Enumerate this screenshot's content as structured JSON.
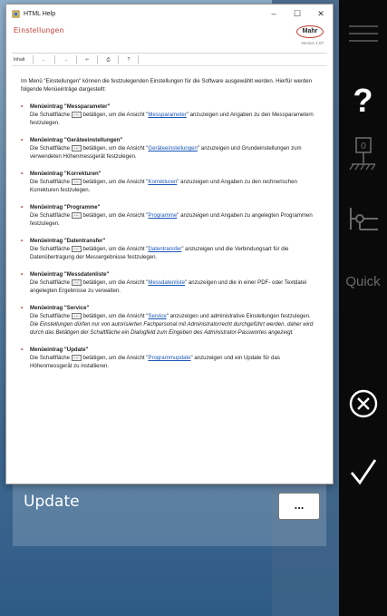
{
  "background": {
    "tile_label": "Update",
    "more_button": "..."
  },
  "right_panel": {
    "help": "?",
    "zero": "0",
    "quick": "Quick"
  },
  "window": {
    "title": "HTML Help",
    "minimize": "–",
    "maximize": "☐",
    "close": "✕"
  },
  "header": {
    "title": "Einstellungen",
    "logo": "Mahr",
    "version": "Version 1.07"
  },
  "toolbar": [
    "Inhalt",
    "←",
    "→",
    "⇐",
    "⎙",
    "?"
  ],
  "content": {
    "intro": "Im Menü \"Einstellungen\" können die festzulegenden Einstellungen für die Software ausgewählt werden. Hierfür werden folgende Menüeinträge dargestellt:",
    "entries": [
      {
        "heading": "Menüeintrag \"Messparameter\"",
        "pre": "Die Schaltfläche",
        "mid": "betätigen, um die Ansicht \"",
        "link": "Messparameter",
        "post": "\" anzuzeigen und Angaben zu den Messparametern festzulegen."
      },
      {
        "heading": "Menüeintrag \"Geräteeinstellungen\"",
        "pre": "Die Schaltfläche",
        "mid": "betätigen, um die Ansicht \"",
        "link": "Geräteeinstellungen",
        "post": "\" anzuzeigen und Grundeinstellungen zum verwendeten Höhenmessgerät festzulegen."
      },
      {
        "heading": "Menüeintrag \"Korrekturen\"",
        "pre": "Die Schaltfläche",
        "mid": "betätigen, um die Ansicht \"",
        "link": "Korrekturen",
        "post": "\" anzuzeigen und Angaben zu den rechnerischen Korrekturen festzulegen."
      },
      {
        "heading": "Menüeintrag \"Programme\"",
        "pre": "Die Schaltfläche",
        "mid": "betätigen, um die Ansicht \"",
        "link": "Programme",
        "post": "\" anzuzeigen und Angaben zu angelegten Programmen festzulegen."
      },
      {
        "heading": "Menüeintrag \"Datentransfer\"",
        "pre": "Die Schaltfläche",
        "mid": "betätigen, um die Ansicht \"",
        "link": "Datentransfer",
        "post": "\" anzuzeigen und die Verbindungsart für die Datenübertragung der Messergebnisse festzulegen."
      },
      {
        "heading": "Menüeintrag \"Messdatenliste\"",
        "pre": "Die Schaltfläche",
        "mid": "betätigen, um die Ansicht \"",
        "link": "Messdatenliste",
        "post": "\" anzuzeigen und die in einer PDF- oder Textdatei angelegten Ergebnisse zu verwalten."
      },
      {
        "heading": "Menüeintrag \"Service\"",
        "pre": "Die Schaltfläche",
        "mid": "betätigen, um die Ansicht \"",
        "link": "Service",
        "post": "\" anzuzeigen und administrative Einstellungen festzulegen.",
        "note": "Die Einstellungen dürfen nur von autorisierten Fachpersonal mit Administratorrecht durchgeführt werden, daher wird durch das Betätigen der Schaltfläche ein Dialogfeld zum Eingeben des Administrator-Passwortes angezeigt."
      },
      {
        "heading": "Menüeintrag \"Update\"",
        "pre": "Die Schaltfläche",
        "mid": "betätigen, um die Ansicht \"",
        "link": "Programmupdate",
        "post": "\" anzuzeigen und ein Update für das Höhenmessgerät zu installieren."
      }
    ]
  },
  "colors": {
    "accent_red": "#c0392b",
    "link_blue": "#1a56b8",
    "panel_black": "#0a0a0a"
  }
}
